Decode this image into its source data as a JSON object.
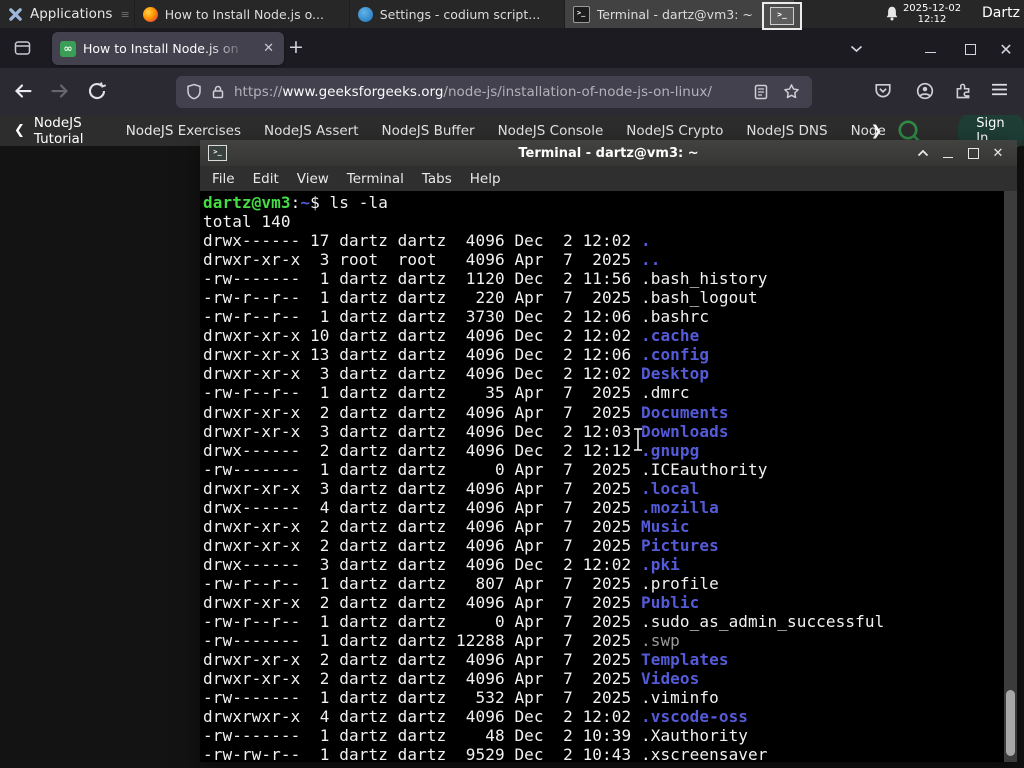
{
  "panel": {
    "applications": {
      "label": "Applications"
    },
    "taskbar": [
      {
        "title": "How to Install Node.js o...",
        "icon": "firefox",
        "active": false
      },
      {
        "title": "Settings - codium script...",
        "icon": "codium",
        "active": false
      },
      {
        "title": "Terminal - dartz@vm3: ~",
        "icon": "terminal",
        "active": true
      }
    ],
    "clock": {
      "date": "2025-12-02",
      "time": "12:12"
    },
    "user": "Dartz"
  },
  "browser": {
    "tab": {
      "title": "How to Install Node.js on"
    },
    "url": {
      "scheme": "https://",
      "domain": "www.geeksforgeeks.org",
      "path": "/node-js/installation-of-node-js-on-linux/"
    }
  },
  "site_nav": {
    "primary": "NodeJS Tutorial",
    "items": [
      "NodeJS Exercises",
      "NodeJS Assert",
      "NodeJS Buffer",
      "NodeJS Console",
      "NodeJS Crypto",
      "NodeJS DNS",
      "Node"
    ],
    "sign_in": "Sign In"
  },
  "terminal": {
    "title": "Terminal - dartz@vm3: ~",
    "menus": [
      "File",
      "Edit",
      "View",
      "Terminal",
      "Tabs",
      "Help"
    ],
    "prompt": {
      "user_host": "dartz@vm3",
      "colon": ":",
      "cwd": "~",
      "suffix": "$ ",
      "command": "ls -la"
    },
    "total": "total 140",
    "listing": [
      {
        "meta": "drwx------ 17 dartz dartz  4096 Dec  2 12:02 ",
        "name": ".",
        "type": "dir"
      },
      {
        "meta": "drwxr-xr-x  3 root  root   4096 Apr  7  2025 ",
        "name": "..",
        "type": "dir"
      },
      {
        "meta": "-rw-------  1 dartz dartz  1120 Dec  2 11:56 ",
        "name": ".bash_history",
        "type": "file"
      },
      {
        "meta": "-rw-r--r--  1 dartz dartz   220 Apr  7  2025 ",
        "name": ".bash_logout",
        "type": "file"
      },
      {
        "meta": "-rw-r--r--  1 dartz dartz  3730 Dec  2 12:06 ",
        "name": ".bashrc",
        "type": "file"
      },
      {
        "meta": "drwxr-xr-x 10 dartz dartz  4096 Dec  2 12:02 ",
        "name": ".cache",
        "type": "dir"
      },
      {
        "meta": "drwxr-xr-x 13 dartz dartz  4096 Dec  2 12:06 ",
        "name": ".config",
        "type": "dir"
      },
      {
        "meta": "drwxr-xr-x  3 dartz dartz  4096 Dec  2 12:02 ",
        "name": "Desktop",
        "type": "dir"
      },
      {
        "meta": "-rw-r--r--  1 dartz dartz    35 Apr  7  2025 ",
        "name": ".dmrc",
        "type": "file"
      },
      {
        "meta": "drwxr-xr-x  2 dartz dartz  4096 Apr  7  2025 ",
        "name": "Documents",
        "type": "dir"
      },
      {
        "meta": "drwxr-xr-x  3 dartz dartz  4096 Dec  2 12:03 ",
        "name": "Downloads",
        "type": "dir"
      },
      {
        "meta": "drwx------  2 dartz dartz  4096 Dec  2 12:12 ",
        "name": ".gnupg",
        "type": "dir"
      },
      {
        "meta": "-rw-------  1 dartz dartz     0 Apr  7  2025 ",
        "name": ".ICEauthority",
        "type": "file"
      },
      {
        "meta": "drwxr-xr-x  3 dartz dartz  4096 Apr  7  2025 ",
        "name": ".local",
        "type": "dir"
      },
      {
        "meta": "drwx------  4 dartz dartz  4096 Apr  7  2025 ",
        "name": ".mozilla",
        "type": "dir"
      },
      {
        "meta": "drwxr-xr-x  2 dartz dartz  4096 Apr  7  2025 ",
        "name": "Music",
        "type": "dir"
      },
      {
        "meta": "drwxr-xr-x  2 dartz dartz  4096 Apr  7  2025 ",
        "name": "Pictures",
        "type": "dir"
      },
      {
        "meta": "drwx------  3 dartz dartz  4096 Dec  2 12:02 ",
        "name": ".pki",
        "type": "dir"
      },
      {
        "meta": "-rw-r--r--  1 dartz dartz   807 Apr  7  2025 ",
        "name": ".profile",
        "type": "file"
      },
      {
        "meta": "drwxr-xr-x  2 dartz dartz  4096 Apr  7  2025 ",
        "name": "Public",
        "type": "dir"
      },
      {
        "meta": "-rw-r--r--  1 dartz dartz     0 Apr  7  2025 ",
        "name": ".sudo_as_admin_successful",
        "type": "file"
      },
      {
        "meta": "-rw-------  1 dartz dartz 12288 Apr  7  2025 ",
        "name": ".swp",
        "type": "dim"
      },
      {
        "meta": "drwxr-xr-x  2 dartz dartz  4096 Apr  7  2025 ",
        "name": "Templates",
        "type": "dir"
      },
      {
        "meta": "drwxr-xr-x  2 dartz dartz  4096 Apr  7  2025 ",
        "name": "Videos",
        "type": "dir"
      },
      {
        "meta": "-rw-------  1 dartz dartz   532 Apr  7  2025 ",
        "name": ".viminfo",
        "type": "file"
      },
      {
        "meta": "drwxrwxr-x  4 dartz dartz  4096 Dec  2 12:02 ",
        "name": ".vscode-oss",
        "type": "dir"
      },
      {
        "meta": "-rw-------  1 dartz dartz    48 Dec  2 10:39 ",
        "name": ".Xauthority",
        "type": "file"
      },
      {
        "meta": "-rw-rw-r--  1 dartz dartz  9529 Dec  2 10:43 ",
        "name": ".xscreensaver",
        "type": "file"
      }
    ]
  },
  "colors": {
    "prompt_green": "#44dd44",
    "dir_blue": "#555bd8",
    "dim_gray": "#9a9a9a",
    "gfg_green": "#2f8d46",
    "active_tab": "#42414d",
    "terminal_bg": "#000000"
  }
}
